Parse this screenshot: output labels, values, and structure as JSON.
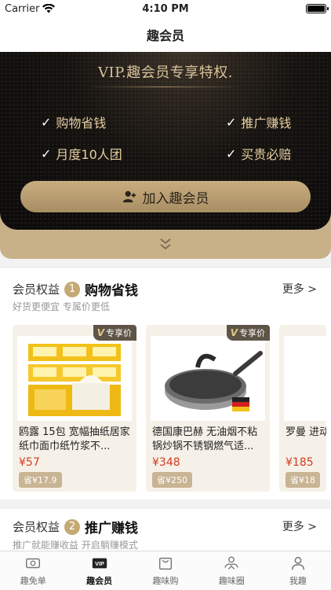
{
  "status_bar": {
    "carrier": "Carrier",
    "time": "4:10 PM",
    "battery_level": 1.0
  },
  "nav": {
    "title": "趣会员"
  },
  "vip": {
    "title": "VIP.趣会员专享特权.",
    "benefits": [
      "购物省钱",
      "推广赚钱",
      "月度10人团",
      "买贵必赔"
    ],
    "join_label": "加入趣会员"
  },
  "sections": [
    {
      "label": "会员权益",
      "number": "1",
      "title": "购物省钱",
      "more": "更多 >",
      "subtitle": "好货更便宜 专属价更低",
      "products": [
        {
          "badge": "专享价",
          "name": "鸥露 15包 宽幅抽纸居家纸巾面巾纸竹浆不...",
          "price": "¥57",
          "save": "省¥17.9"
        },
        {
          "badge": "专享价",
          "name": "德国康巴赫 无油烟不粘锅炒锅不锈钢燃气适...",
          "price": "¥348",
          "save": "省¥250"
        },
        {
          "badge": "",
          "name": "罗曼 进动牙刷",
          "price": "¥185",
          "save": "省¥18"
        }
      ]
    },
    {
      "label": "会员权益",
      "number": "2",
      "title": "推广赚钱",
      "more": "更多 >",
      "subtitle": "推广就能赚收益 开启躺赚模式"
    }
  ],
  "tabs": [
    {
      "label": "趣免单",
      "icon": "ticket-icon",
      "active": false
    },
    {
      "label": "趣会员",
      "icon": "vip-icon",
      "active": true
    },
    {
      "label": "趣味购",
      "icon": "bag-icon",
      "active": false
    },
    {
      "label": "趣味圈",
      "icon": "handshake-icon",
      "active": false
    },
    {
      "label": "我趣",
      "icon": "person-icon",
      "active": false
    }
  ],
  "colors": {
    "gold": "#c5a973",
    "price_red": "#d43b20",
    "dark_bg": "#0c0b0a"
  }
}
